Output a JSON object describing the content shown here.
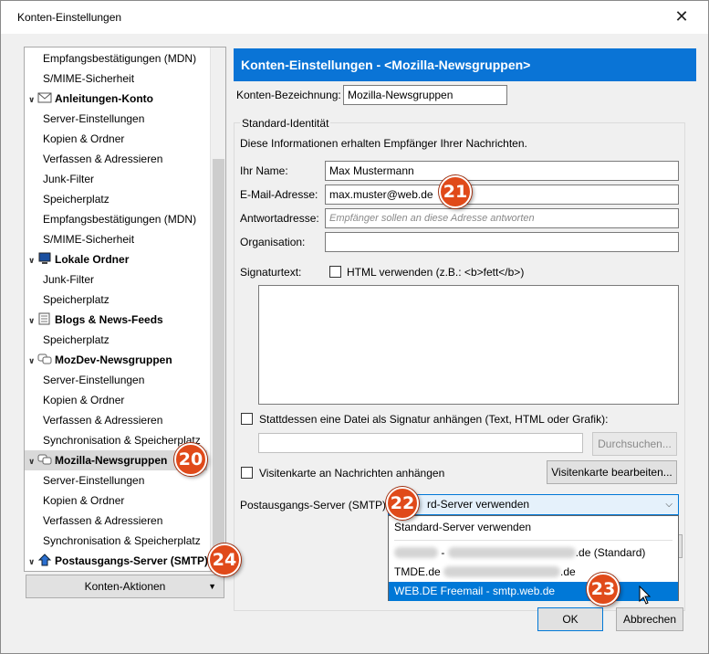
{
  "window": {
    "title": "Konten-Einstellungen"
  },
  "tree": {
    "items": [
      {
        "label": "Empfangsbestätigungen (MDN)",
        "kind": "child"
      },
      {
        "label": "S/MIME-Sicherheit",
        "kind": "child"
      },
      {
        "label": "Anleitungen-Konto",
        "kind": "account",
        "icon": "mail-icon"
      },
      {
        "label": "Server-Einstellungen",
        "kind": "child"
      },
      {
        "label": "Kopien & Ordner",
        "kind": "child"
      },
      {
        "label": "Verfassen & Adressieren",
        "kind": "child"
      },
      {
        "label": "Junk-Filter",
        "kind": "child"
      },
      {
        "label": "Speicherplatz",
        "kind": "child"
      },
      {
        "label": "Empfangsbestätigungen (MDN)",
        "kind": "child"
      },
      {
        "label": "S/MIME-Sicherheit",
        "kind": "child"
      },
      {
        "label": "Lokale Ordner",
        "kind": "account",
        "icon": "computer-icon"
      },
      {
        "label": "Junk-Filter",
        "kind": "child"
      },
      {
        "label": "Speicherplatz",
        "kind": "child"
      },
      {
        "label": "Blogs & News-Feeds",
        "kind": "account",
        "icon": "feed-icon"
      },
      {
        "label": "Speicherplatz",
        "kind": "child"
      },
      {
        "label": "MozDev-Newsgruppen",
        "kind": "account",
        "icon": "newsgroup-icon"
      },
      {
        "label": "Server-Einstellungen",
        "kind": "child"
      },
      {
        "label": "Kopien & Ordner",
        "kind": "child"
      },
      {
        "label": "Verfassen & Adressieren",
        "kind": "child"
      },
      {
        "label": "Synchronisation & Speicherplatz",
        "kind": "child"
      },
      {
        "label": "Mozilla-Newsgruppen",
        "kind": "account",
        "icon": "newsgroup-icon",
        "selected": true
      },
      {
        "label": "Server-Einstellungen",
        "kind": "child"
      },
      {
        "label": "Kopien & Ordner",
        "kind": "child"
      },
      {
        "label": "Verfassen & Adressieren",
        "kind": "child"
      },
      {
        "label": "Synchronisation & Speicherplatz",
        "kind": "child"
      },
      {
        "label": "Postausgangs-Server (SMTP)",
        "kind": "account",
        "icon": "outgoing-server-icon"
      }
    ],
    "actions_label": "Konten-Aktionen"
  },
  "panel": {
    "header": "Konten-Einstellungen - <Mozilla-Newsgruppen>",
    "account_name_label": "Konten-Bezeichnung:",
    "account_name_value": "Mozilla-Newsgruppen",
    "identity_group_label": "Standard-Identität",
    "identity_desc": "Diese Informationen erhalten Empfänger Ihrer Nachrichten.",
    "name_label": "Ihr Name:",
    "name_value": "Max Mustermann",
    "email_label": "E-Mail-Adresse:",
    "email_value": "max.muster@web.de",
    "reply_label": "Antwortadresse:",
    "reply_placeholder": "Empfänger sollen an diese Adresse antworten",
    "org_label": "Organisation:",
    "org_value": "",
    "signature_label": "Signaturtext:",
    "html_checkbox_label": "HTML verwenden (z.B.: <b>fett</b>)",
    "attach_file_label": "Stattdessen eine Datei als Signatur anhängen (Text, HTML oder Grafik):",
    "browse_label": "Durchsuchen...",
    "vcard_label": "Visitenkarte an Nachrichten anhängen",
    "vcard_edit_label": "Visitenkarte bearbeiten...",
    "smtp_label": "Postausgangs-Server (SMTP):",
    "smtp_selected": "rd-Server verwenden",
    "smtp_options": [
      "Standard-Server verwenden",
      ".de (Standard)",
      "TMDE.de",
      "WEB.DE Freemail - smtp.web.de"
    ],
    "smtp_option_mid_suffix": ".de",
    "ok_label": "OK",
    "cancel_label": "Abbrechen"
  },
  "badges": [
    "20",
    "21",
    "22",
    "23",
    "24"
  ],
  "colors": {
    "header": "#0a74d6",
    "highlight": "#0078d7",
    "badge": "#e04a1a"
  }
}
